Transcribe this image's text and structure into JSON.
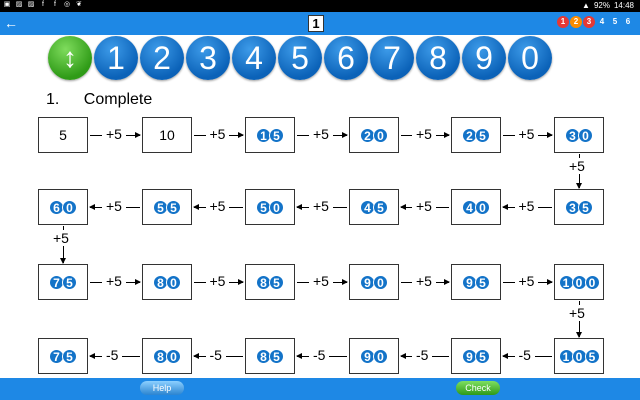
{
  "statusbar": {
    "left_icons": [
      "screenshot-icon",
      "image-icon",
      "image-icon",
      "facebook-icon",
      "facebook-icon",
      "instagram-icon",
      "twitter-icon"
    ],
    "signal": "▲",
    "battery": "92%",
    "time": "14:48"
  },
  "appbar": {
    "back": "←",
    "page": "1",
    "logo_digits": [
      "1",
      "2",
      "3",
      "4",
      "5",
      "6"
    ],
    "logo_colors": [
      "#e53935",
      "#fb8c00",
      "#e53935",
      "#1e88e5",
      "#1e88e5",
      "#1e88e5"
    ]
  },
  "digitbar": {
    "toggle": "↕",
    "digits": [
      "1",
      "2",
      "3",
      "4",
      "5",
      "6",
      "7",
      "8",
      "9",
      "0"
    ]
  },
  "task": {
    "number": "1.",
    "title": "Complete"
  },
  "rows": [
    {
      "boxes": [
        {
          "value": "5",
          "style": "plain"
        },
        {
          "value": "10",
          "style": "plain"
        },
        {
          "value": "15",
          "style": "ball"
        },
        {
          "value": "20",
          "style": "ball"
        },
        {
          "value": "25",
          "style": "ball"
        },
        {
          "value": "30",
          "style": "ball"
        }
      ],
      "op": "+5",
      "dir": "right"
    },
    {
      "boxes": [
        {
          "value": "60",
          "style": "ball"
        },
        {
          "value": "55",
          "style": "ball"
        },
        {
          "value": "50",
          "style": "ball"
        },
        {
          "value": "45",
          "style": "ball"
        },
        {
          "value": "40",
          "style": "ball"
        },
        {
          "value": "35",
          "style": "ball"
        }
      ],
      "op": "+5",
      "dir": "left"
    },
    {
      "boxes": [
        {
          "value": "75",
          "style": "ball"
        },
        {
          "value": "80",
          "style": "ball"
        },
        {
          "value": "85",
          "style": "ball"
        },
        {
          "value": "90",
          "style": "ball"
        },
        {
          "value": "95",
          "style": "ball"
        },
        {
          "value": "100",
          "style": "ball"
        }
      ],
      "op": "+5",
      "dir": "right"
    },
    {
      "boxes": [
        {
          "value": "75",
          "style": "ball"
        },
        {
          "value": "80",
          "style": "ball"
        },
        {
          "value": "85",
          "style": "ball"
        },
        {
          "value": "90",
          "style": "ball"
        },
        {
          "value": "95",
          "style": "ball"
        },
        {
          "value": "105",
          "style": "ball"
        }
      ],
      "op": "-5",
      "dir": "left"
    }
  ],
  "vertical_ops": [
    {
      "label": "+5",
      "side": "right"
    },
    {
      "label": "+5",
      "side": "left"
    },
    {
      "label": "+5",
      "side": "right"
    }
  ],
  "bottombar": {
    "help": "Help",
    "check": "Check"
  }
}
